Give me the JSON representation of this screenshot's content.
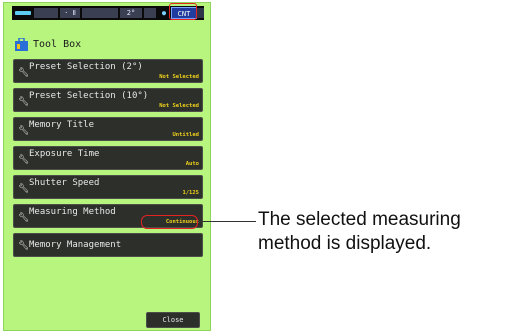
{
  "status_bar": {
    "cells": [
      "",
      "· Ⅱ",
      "",
      "2°",
      "",
      "●"
    ],
    "mode_badge": "CNT",
    "highlight_color": "#e32222"
  },
  "header": {
    "icon": "toolbox-icon",
    "title": "Tool Box"
  },
  "menu": {
    "item_icon": "wrench-icon",
    "items": [
      {
        "label": "Preset Selection (2°)",
        "value": "Not Selected"
      },
      {
        "label": "Preset Selection (10°)",
        "value": "Not Selected"
      },
      {
        "label": "Memory Title",
        "value": "Untitled"
      },
      {
        "label": "Exposure Time",
        "value": "Auto"
      },
      {
        "label": "Shutter Speed",
        "value": "1/125"
      },
      {
        "label": "Measuring Method",
        "value": "Continuous"
      },
      {
        "label": "Memory Management",
        "value": ""
      }
    ]
  },
  "close_button": {
    "label": "Close"
  },
  "callout": {
    "text": "The selected measuring method is displayed."
  },
  "colors": {
    "screen_bg": "#b7f57e",
    "item_bg": "#2d2f2b",
    "value_text": "#f0d21a",
    "highlight": "#e32222"
  }
}
